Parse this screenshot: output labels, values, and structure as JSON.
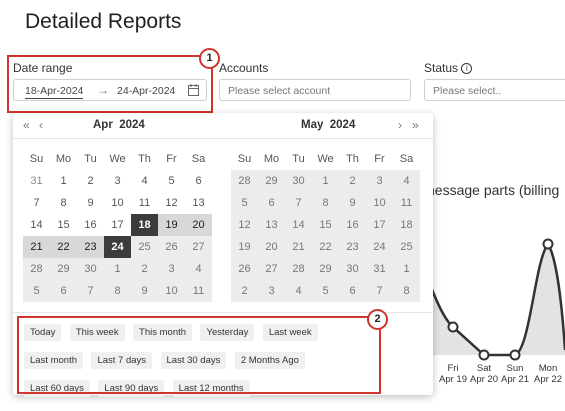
{
  "page": {
    "title": "Detailed Reports"
  },
  "filters": {
    "date_range": {
      "label": "Date range",
      "start": "18-Apr-2024",
      "arrow": "→",
      "end": "24-Apr-2024"
    },
    "accounts": {
      "label": "Accounts",
      "placeholder": "Please select account"
    },
    "status": {
      "label": "Status",
      "placeholder": "Please select.."
    }
  },
  "annotations": {
    "badge_1": "1",
    "badge_2": "2"
  },
  "calendar": {
    "nav": {
      "prev_year": "«",
      "prev_month": "‹",
      "next_month": "›",
      "next_year": "»"
    },
    "weekdays": [
      "Su",
      "Mo",
      "Tu",
      "We",
      "Th",
      "Fr",
      "Sa"
    ],
    "left": {
      "month": "Apr",
      "year": "2024"
    },
    "right": {
      "month": "May",
      "year": "2024"
    }
  },
  "presets": [
    "Today",
    "This week",
    "This month",
    "Yesterday",
    "Last week",
    "Last month",
    "Last 7 days",
    "Last 30 days",
    "2 Months Ago",
    "Last 60 days",
    "Last 90 days",
    "Last 12 months"
  ],
  "chart": {
    "title_fragment": "nessage parts (billing",
    "x_labels": [
      {
        "day": "Fri",
        "date": "Apr 19"
      },
      {
        "day": "Sat",
        "date": "Apr 20"
      },
      {
        "day": "Sun",
        "date": "Apr 21"
      },
      {
        "day": "Mon",
        "date": "Apr 22"
      }
    ]
  },
  "colors": {
    "annotation": "#d0342c",
    "endpoint": "#3c3c3c",
    "range": "#d8d8d8"
  }
}
